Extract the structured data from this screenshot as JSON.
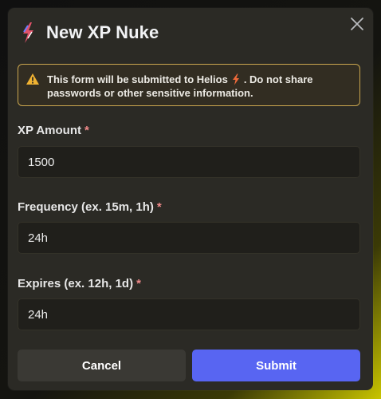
{
  "dialog": {
    "title": "New XP Nuke",
    "app_icon": "lightning-bolt-icon",
    "close_icon": "close-icon"
  },
  "warning": {
    "icon": "warning-triangle-icon",
    "text_before": "This form will be submitted to ",
    "app_name": "Helios",
    "text_after": ". Do not share passwords or other sensitive information.",
    "bolt_icon": "lightning-bolt-icon",
    "border_color": "#c9a54e"
  },
  "fields": {
    "xp_amount": {
      "label": "XP Amount",
      "required": "*",
      "value": "1500"
    },
    "frequency": {
      "label": "Frequency (ex. 15m, 1h)",
      "required": "*",
      "value": "24h"
    },
    "expires": {
      "label": "Expires (ex. 12h, 1d)",
      "required": "*",
      "value": "24h"
    }
  },
  "buttons": {
    "cancel": "Cancel",
    "submit": "Submit",
    "submit_color": "#5865f2"
  }
}
